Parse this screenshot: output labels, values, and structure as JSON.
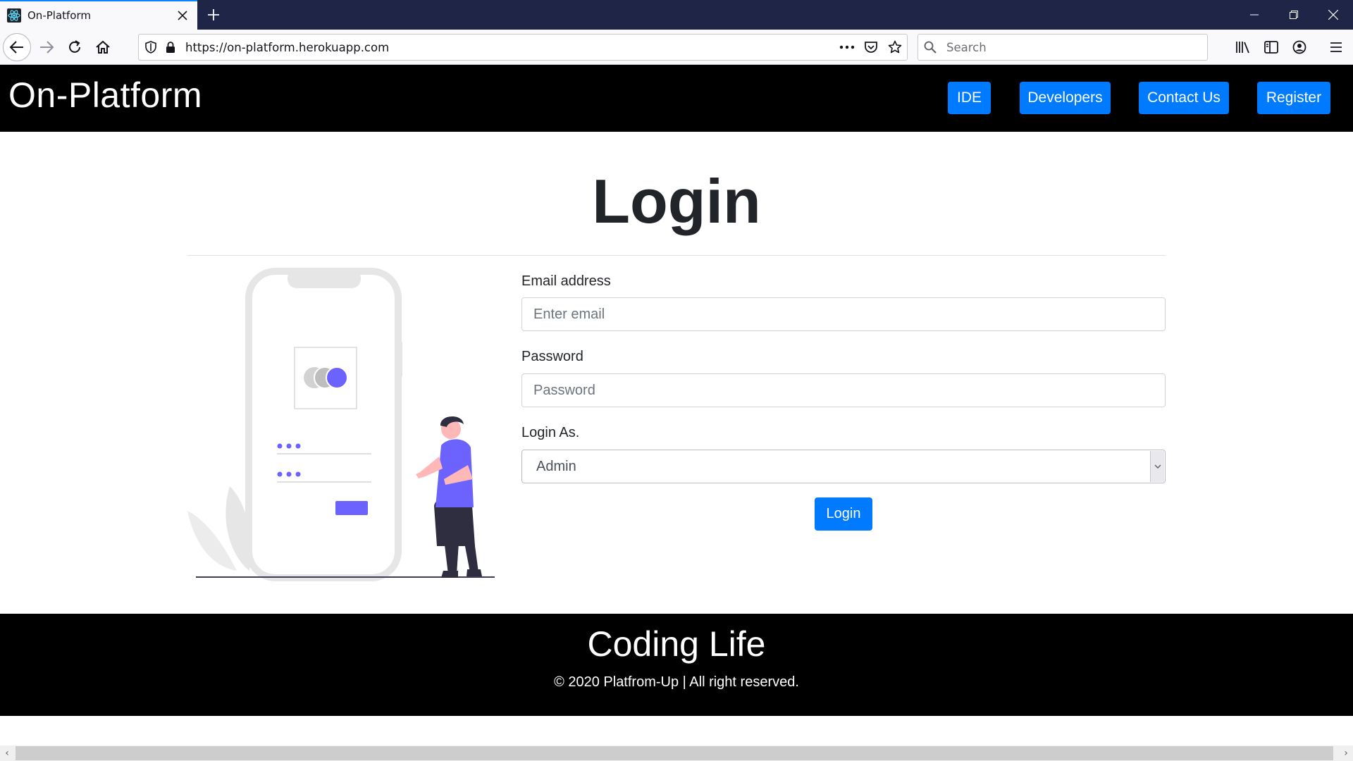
{
  "browser": {
    "tab_title": "On-Platform",
    "url": "https://on-platform.herokuapp.com",
    "search_placeholder": "Search"
  },
  "header": {
    "brand": "On-Platform",
    "nav": [
      "IDE",
      "Developers",
      "Contact Us",
      "Register"
    ]
  },
  "main": {
    "title": "Login",
    "email_label": "Email address",
    "email_placeholder": "Enter email",
    "password_label": "Password",
    "password_placeholder": "Password",
    "login_as_label": "Login As.",
    "login_as_value": "Admin",
    "submit_label": "Login"
  },
  "footer": {
    "title": "Coding Life",
    "copyright": "© 2020 Platfrom-Up | All right reserved."
  },
  "colors": {
    "primary": "#007bff",
    "header_bg": "#000000",
    "accent_purple": "#6c63ff"
  }
}
